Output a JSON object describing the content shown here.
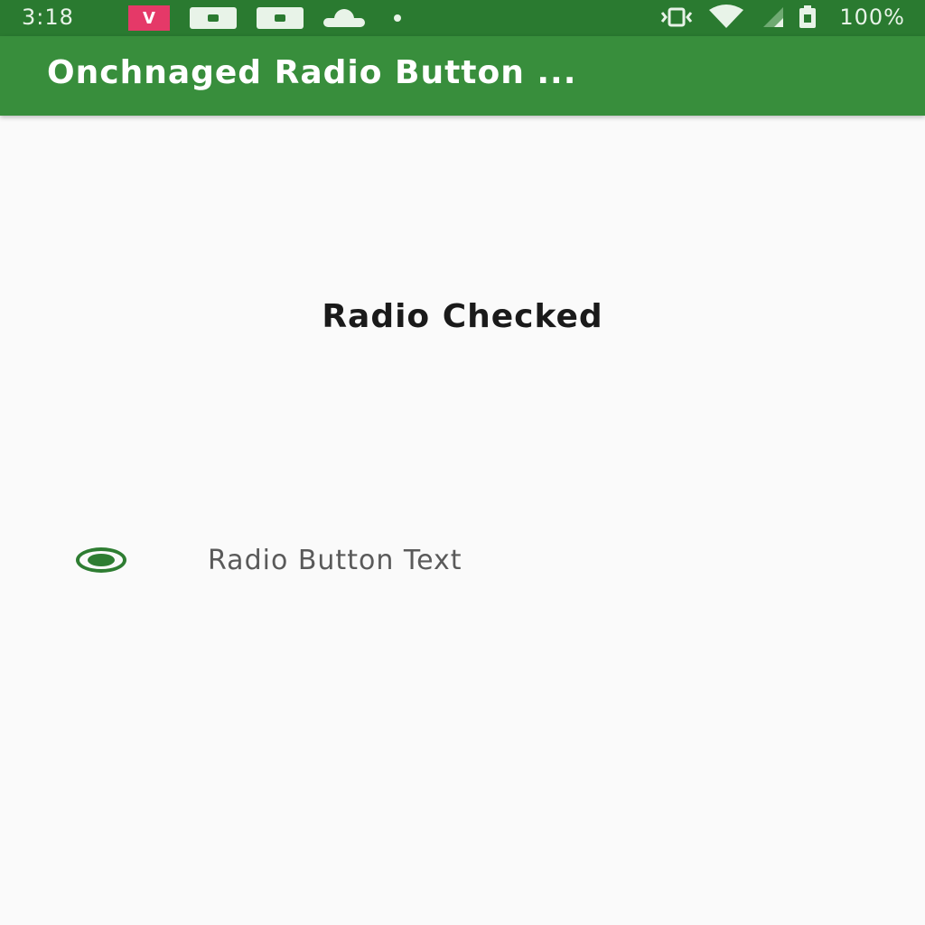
{
  "status_bar": {
    "time": "3:18",
    "notification_icons": [
      "v-app-icon",
      "message-icon",
      "message-icon",
      "cloud-icon",
      "dot-icon"
    ],
    "notification_v_letter": "V",
    "system_icons": [
      "vibrate-icon",
      "wifi-icon",
      "signal-icon",
      "battery-icon"
    ],
    "battery": "100%"
  },
  "app_bar": {
    "title": "Onchnaged Radio Button ...",
    "color": "#388e3c"
  },
  "main": {
    "status_text": "Radio Checked",
    "radio": {
      "label": "Radio Button Text",
      "checked": true,
      "accent_color": "#2e7d32"
    }
  }
}
